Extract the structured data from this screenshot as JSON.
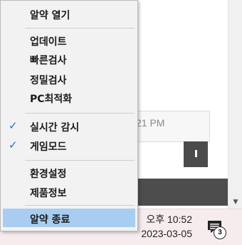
{
  "background": {
    "notification_time": "21 PM"
  },
  "menu": {
    "items": [
      {
        "label": "알약 열기",
        "checked": false
      },
      {
        "label": "업데이트",
        "checked": false
      },
      {
        "label": "빠른검사",
        "checked": false
      },
      {
        "label": "정밀검사",
        "checked": false
      },
      {
        "label": "PC최적화",
        "checked": false
      },
      {
        "label": "실시간 감시",
        "checked": true,
        "check_icon": "checkmark-icon"
      },
      {
        "label": "게임모드",
        "checked": true,
        "check_icon": "checkmark-icon"
      },
      {
        "label": "환경설정",
        "checked": false
      },
      {
        "label": "제품정보",
        "checked": false
      },
      {
        "label": "알약 종료",
        "checked": false,
        "highlighted": true
      }
    ],
    "highlight_color": "#a9cdf0",
    "check_color": "#1f6fcf"
  },
  "taskbar": {
    "time": "오후 10:52",
    "date": "2023-03-05",
    "notification_count": "3",
    "notification_icon": "action-center-icon"
  }
}
